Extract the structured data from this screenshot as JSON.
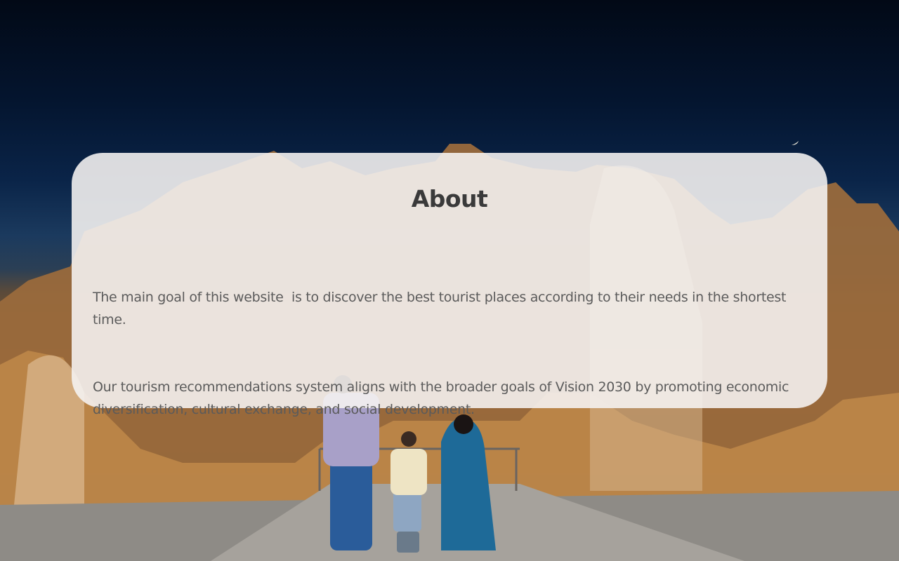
{
  "about": {
    "title": "About",
    "paragraph_1": "The main goal of this website  is to discover the best tourist places according to their needs in the shortest time.",
    "paragraph_2": "Our tourism recommendations system aligns with the broader goals of Vision 2030 by promoting economic diversification, cultural exchange, and social development."
  },
  "background": {
    "image": "night-heritage-site-family-photo",
    "sky_color": "#04152f",
    "lit_wall_color": "#8a5a2c"
  }
}
